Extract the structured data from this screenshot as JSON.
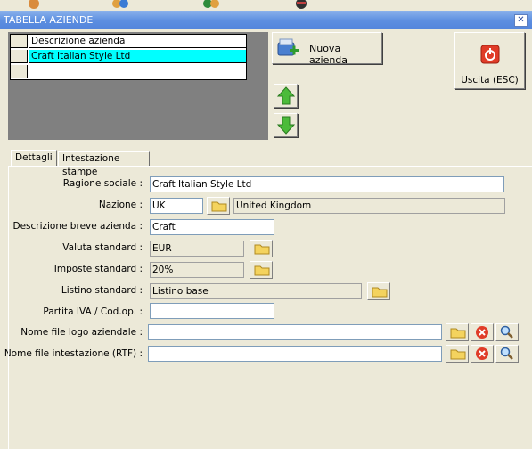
{
  "window": {
    "title": "TABELLA AZIENDE",
    "close_icon": "close-icon"
  },
  "grid": {
    "column_header": "Descrizione azienda",
    "rows": [
      "Craft Italian Style Ltd",
      ""
    ]
  },
  "buttons": {
    "new_company": "Nuova azienda",
    "exit": "Uscita (ESC)"
  },
  "tabs": [
    "Dettagli",
    "Intestazione stampe"
  ],
  "form": {
    "ragione_sociale": {
      "label": "Ragione sociale :",
      "value": "Craft Italian Style Ltd"
    },
    "nazione": {
      "label": "Nazione :",
      "code": "UK",
      "name": "United Kingdom"
    },
    "descrizione_breve": {
      "label": "Descrizione breve azienda :",
      "value": "Craft"
    },
    "valuta": {
      "label": "Valuta standard :",
      "value": "EUR"
    },
    "imposte": {
      "label": "Imposte standard :",
      "value": "20%"
    },
    "listino": {
      "label": "Listino standard :",
      "value": "Listino base"
    },
    "partita_iva": {
      "label": "Partita IVA / Cod.op. :",
      "value": ""
    },
    "logo_file": {
      "label": "Nome file logo aziendale :",
      "value": ""
    },
    "intestazione_file": {
      "label": "Nome file intestazione (RTF) :",
      "value": ""
    }
  },
  "colors": {
    "selection": "#00ffff",
    "titlebar": "#5c8ee0",
    "exit_icon": "#e03c28"
  }
}
